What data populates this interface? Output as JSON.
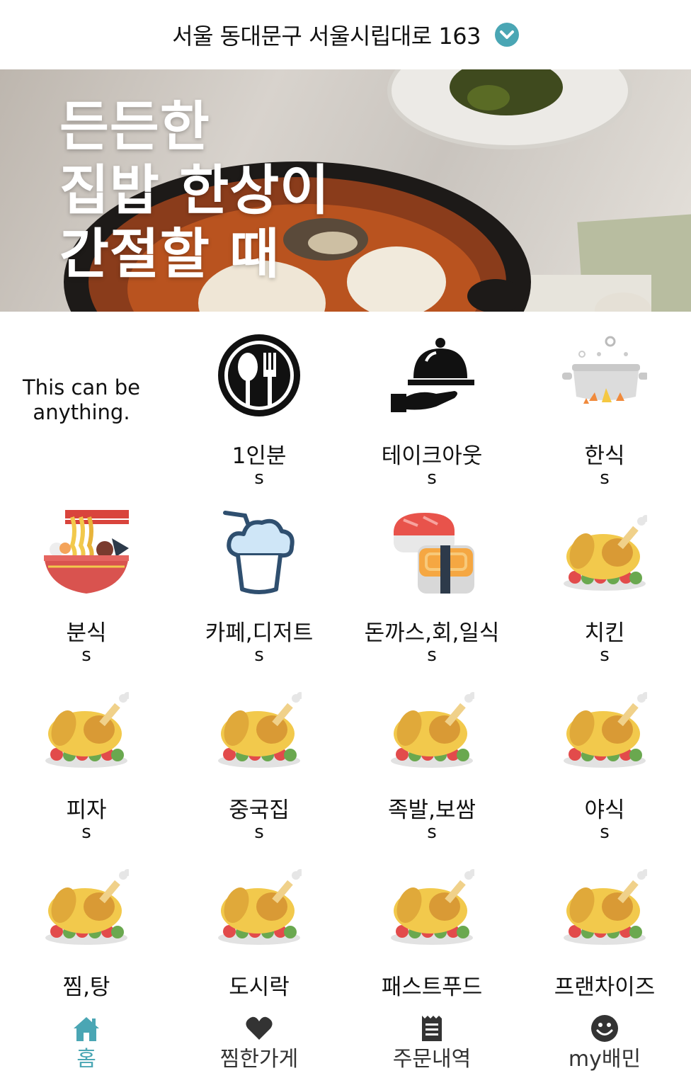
{
  "header": {
    "address": "서울 동대문구 서울시립대로 163",
    "chevron_icon": "chevron-down-circle-icon",
    "accent_color": "#4aa6b4"
  },
  "banner": {
    "lines": [
      "든든한",
      "집밥 한상이",
      "간절할 때"
    ]
  },
  "grid": {
    "placeholder_text": "This can be anything.",
    "categories": [
      {
        "label": "1인분",
        "sub": "s",
        "icon": "spoon-fork-icon"
      },
      {
        "label": "테이크아웃",
        "sub": "s",
        "icon": "cloche-hand-icon"
      },
      {
        "label": "한식",
        "sub": "s",
        "icon": "cooking-pot-icon"
      },
      {
        "label": "분식",
        "sub": "s",
        "icon": "noodle-bowl-icon"
      },
      {
        "label": "카페,디저트",
        "sub": "s",
        "icon": "drink-cup-icon"
      },
      {
        "label": "돈까스,회,일식",
        "sub": "s",
        "icon": "sushi-icon"
      },
      {
        "label": "치킨",
        "sub": "s",
        "icon": "roast-chicken-icon"
      },
      {
        "label": "피자",
        "sub": "s",
        "icon": "roast-chicken-icon"
      },
      {
        "label": "중국집",
        "sub": "s",
        "icon": "roast-chicken-icon"
      },
      {
        "label": "족발,보쌈",
        "sub": "s",
        "icon": "roast-chicken-icon"
      },
      {
        "label": "야식",
        "sub": "s",
        "icon": "roast-chicken-icon"
      },
      {
        "label": "찜,탕",
        "sub": "",
        "icon": "roast-chicken-icon"
      },
      {
        "label": "도시락",
        "sub": "",
        "icon": "roast-chicken-icon"
      },
      {
        "label": "패스트푸드",
        "sub": "",
        "icon": "roast-chicken-icon"
      },
      {
        "label": "프랜차이즈",
        "sub": "",
        "icon": "roast-chicken-icon"
      }
    ]
  },
  "bottom_nav": {
    "items": [
      {
        "label": "홈",
        "icon": "home-icon",
        "active": true
      },
      {
        "label": "찜한가게",
        "icon": "heart-icon",
        "active": false
      },
      {
        "label": "주문내역",
        "icon": "receipt-icon",
        "active": false
      },
      {
        "label": "my배민",
        "icon": "smiley-icon",
        "active": false
      }
    ]
  }
}
